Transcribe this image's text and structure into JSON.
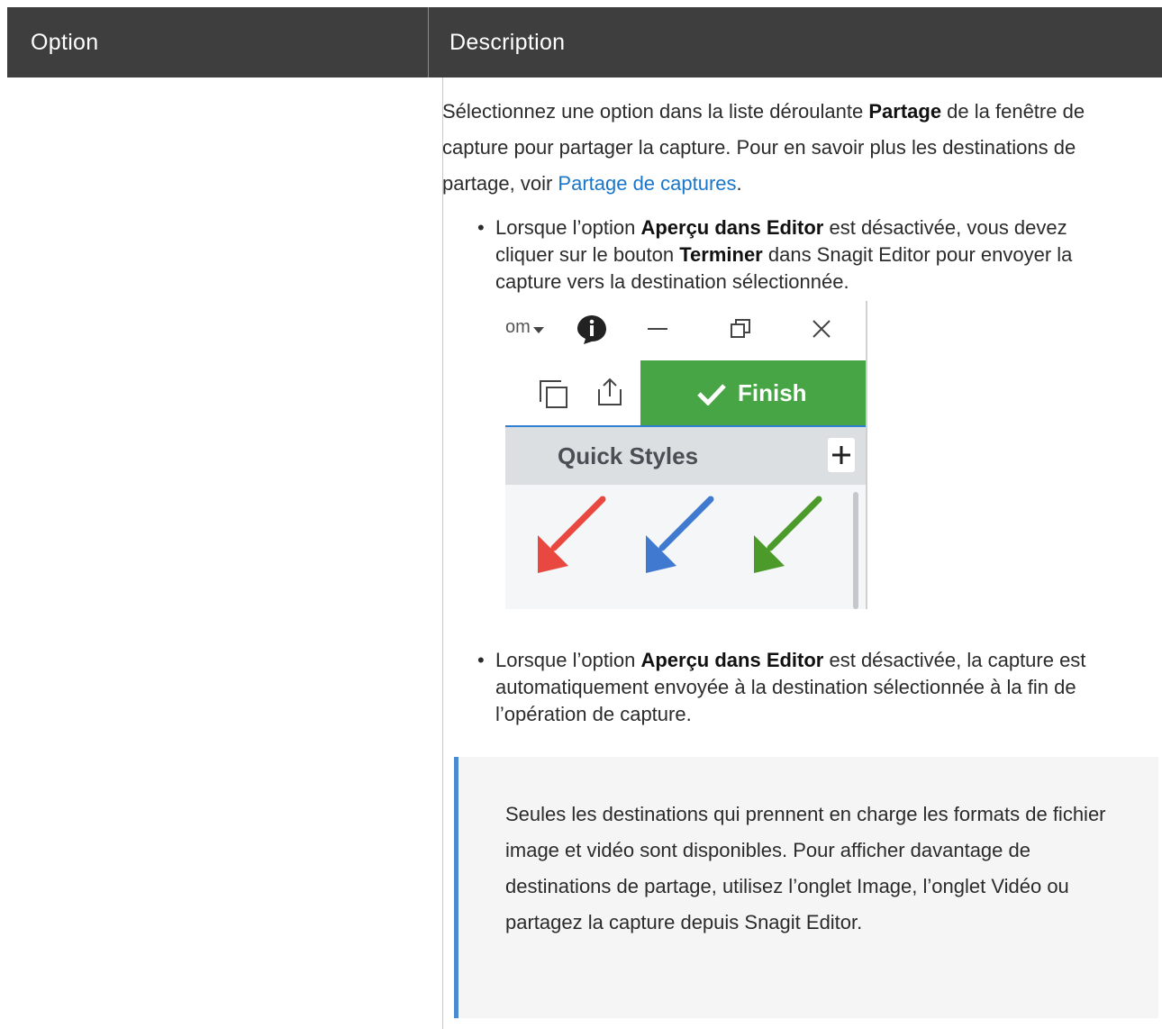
{
  "table": {
    "headers": {
      "option": "Option",
      "description": "Description"
    }
  },
  "intro": {
    "pre": "Sélectionnez une option dans la liste déroulante ",
    "bold": "Partage",
    "mid": " de la fenêtre de capture pour partager la capture. Pour en savoir plus les destinations de partage, voir ",
    "link": "Partage de captures",
    "post": "."
  },
  "bullet1": {
    "pre": "Lorsque l’option ",
    "bold1": "Aperçu dans Editor",
    "mid": " est désactivée, vous devez cliquer sur le bouton ",
    "bold2": "Terminer",
    "post": " dans Snagit Editor pour envoyer la capture vers la destination sélectionnée."
  },
  "screenshot": {
    "menu_fragment": "om",
    "finish_label": "Finish",
    "quick_styles_label": "Quick Styles",
    "arrow_colors": [
      "#e8483f",
      "#3f7ad0",
      "#4c9b2a"
    ],
    "finish_color": "#47a545",
    "icons": [
      "dropdown-caret-icon",
      "info-icon",
      "minimize-icon",
      "restore-icon",
      "close-icon",
      "copy-icon",
      "share-icon",
      "checkmark-icon",
      "plus-icon"
    ]
  },
  "bullet2": {
    "pre": "Lorsque l’option ",
    "bold": "Aperçu dans Editor",
    "post": " est désactivée, la capture est automatiquement envoyée à la destination sélectionnée à la fin de l’opération de capture."
  },
  "note": {
    "text": "Seules les destinations qui prennent en charge les formats de fichier image et vidéo sont disponibles. Pour afficher davantage de destinations de partage, utilisez l’onglet Image, l’onglet Vidéo ou partagez la capture depuis Snagit Editor."
  },
  "colors": {
    "header_bg": "#3e3e3e",
    "link": "#1a76c9",
    "note_border": "#4a8ad2",
    "note_bg": "#f5f5f5"
  }
}
